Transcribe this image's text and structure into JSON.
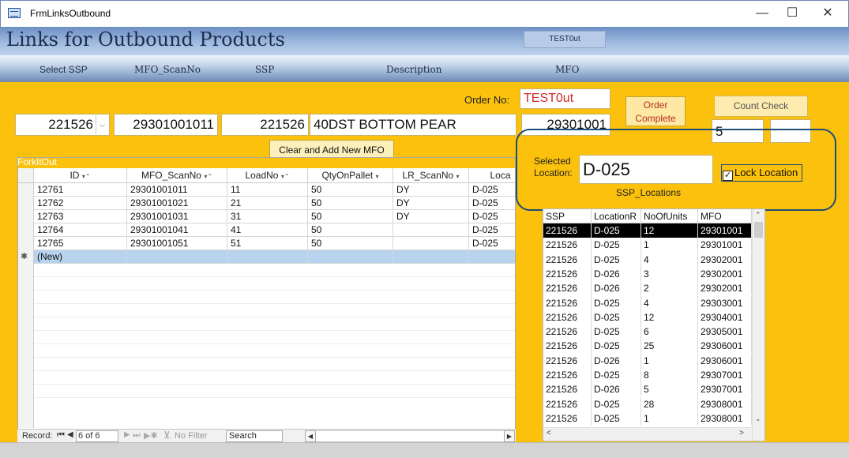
{
  "window": {
    "title": "FrmLinksOutbound",
    "minimize": "—",
    "maximize": "☐",
    "close": "✕"
  },
  "header": {
    "title": "Links for Outbound Products",
    "order_tag": "TEST0ut"
  },
  "column_headers": [
    "Select SSP",
    "MFO_ScanNo",
    "SSP",
    "Description",
    "MFO"
  ],
  "form": {
    "select_ssp": "221526",
    "mfo_scanno": "29301001011",
    "ssp": "221526",
    "description": "40DST BOTTOM PEAR",
    "mfo": "29301001",
    "order_label": "Order No:",
    "order_no": "TEST0ut",
    "order_complete": "Order Complete",
    "count_check": "Count Check",
    "count_value": "5",
    "count_extra": "",
    "clear_btn": "Clear and Add New MFO"
  },
  "datasheet": {
    "caption": "ForkItOut",
    "headers": [
      "ID",
      "MFO_ScanNo",
      "LoadNo",
      "QtyOnPallet",
      "LR_ScanNo",
      "Loca"
    ],
    "rows": [
      [
        "12761",
        "29301001011",
        "11",
        "50",
        "DY",
        "D-025"
      ],
      [
        "12762",
        "29301001021",
        "21",
        "50",
        "DY",
        "D-025"
      ],
      [
        "12763",
        "29301001031",
        "31",
        "50",
        "DY",
        "D-025"
      ],
      [
        "12764",
        "29301001041",
        "41",
        "50",
        "",
        "D-025"
      ],
      [
        "12765",
        "29301001051",
        "51",
        "50",
        "",
        "D-025"
      ]
    ],
    "new_row": "(New)",
    "new_marker": "✱"
  },
  "nav": {
    "record_label": "Record:",
    "record_value": "6 of 6",
    "filter": "No Filter",
    "search": "Search"
  },
  "location": {
    "label": "Selected Location:",
    "value": "D-025",
    "lock_label": "Lock Location",
    "locked": true,
    "list_caption": "SSP_Locations",
    "list_headers": [
      "SSP",
      "LocationR",
      "NoOfUnits",
      "MFO"
    ],
    "list_rows": [
      [
        "221526",
        "D-025",
        "12",
        "29301001"
      ],
      [
        "221526",
        "D-025",
        "1",
        "29301001"
      ],
      [
        "221526",
        "D-025",
        "4",
        "29302001"
      ],
      [
        "221526",
        "D-026",
        "3",
        "29302001"
      ],
      [
        "221526",
        "D-026",
        "2",
        "29302001"
      ],
      [
        "221526",
        "D-025",
        "4",
        "29303001"
      ],
      [
        "221526",
        "D-025",
        "12",
        "29304001"
      ],
      [
        "221526",
        "D-025",
        "6",
        "29305001"
      ],
      [
        "221526",
        "D-025",
        "25",
        "29306001"
      ],
      [
        "221526",
        "D-026",
        "1",
        "29306001"
      ],
      [
        "221526",
        "D-025",
        "8",
        "29307001"
      ],
      [
        "221526",
        "D-026",
        "5",
        "29307001"
      ],
      [
        "221526",
        "D-025",
        "28",
        "29308001"
      ],
      [
        "221526",
        "D-025",
        "1",
        "29308001"
      ]
    ]
  },
  "colors": {
    "form_bg": "#fbc10c",
    "accent_red": "#d0282a",
    "header_blue": "#8faad4",
    "selected_row": "#000000"
  }
}
